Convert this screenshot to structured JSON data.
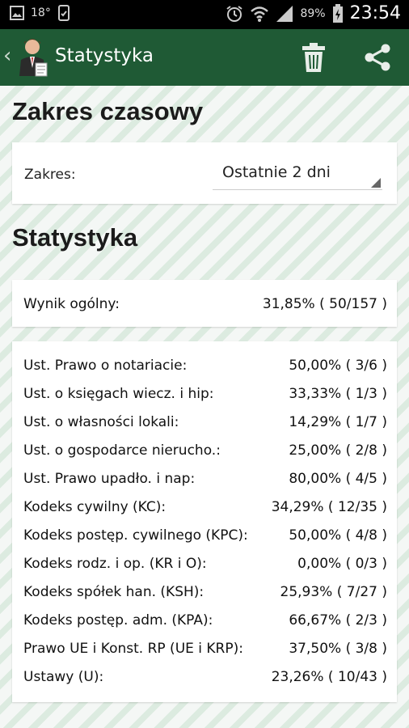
{
  "status_bar": {
    "temperature": "18°",
    "battery": "89%",
    "time": "23:54"
  },
  "action_bar": {
    "title": "Statystyka"
  },
  "time_range": {
    "heading": "Zakres czasowy",
    "label": "Zakres:",
    "selected": "Ostatnie 2 dni"
  },
  "stats": {
    "heading": "Statystyka",
    "overall_label": "Wynik ogólny:",
    "overall_value": "31,85% ( 50/157 )",
    "items": [
      {
        "label": "Ust. Prawo o notariacie:",
        "value": "50,00% ( 3/6 )"
      },
      {
        "label": "Ust. o księgach wiecz. i hip:",
        "value": "33,33% ( 1/3 )"
      },
      {
        "label": "Ust. o własności lokali:",
        "value": "14,29% ( 1/7 )"
      },
      {
        "label": "Ust. o gospodarce nierucho.:",
        "value": "25,00% ( 2/8 )"
      },
      {
        "label": "Ust. Prawo upadło. i nap:",
        "value": "80,00% ( 4/5 )"
      },
      {
        "label": "Kodeks cywilny (KC):",
        "value": "34,29% ( 12/35 )"
      },
      {
        "label": "Kodeks postęp. cywilnego (KPC):",
        "value": "50,00% ( 4/8 )"
      },
      {
        "label": "Kodeks rodz. i op. (KR i O):",
        "value": "0,00% ( 0/3 )"
      },
      {
        "label": "Kodeks spółek han. (KSH):",
        "value": "25,93% ( 7/27 )"
      },
      {
        "label": "Kodeks postęp. adm. (KPA):",
        "value": "66,67% ( 2/3 )"
      },
      {
        "label": "Prawo UE i Konst. RP (UE i KRP):",
        "value": "37,50% ( 3/8 )"
      },
      {
        "label": "Ustawy (U):",
        "value": "23,26% ( 10/43 )"
      }
    ]
  }
}
